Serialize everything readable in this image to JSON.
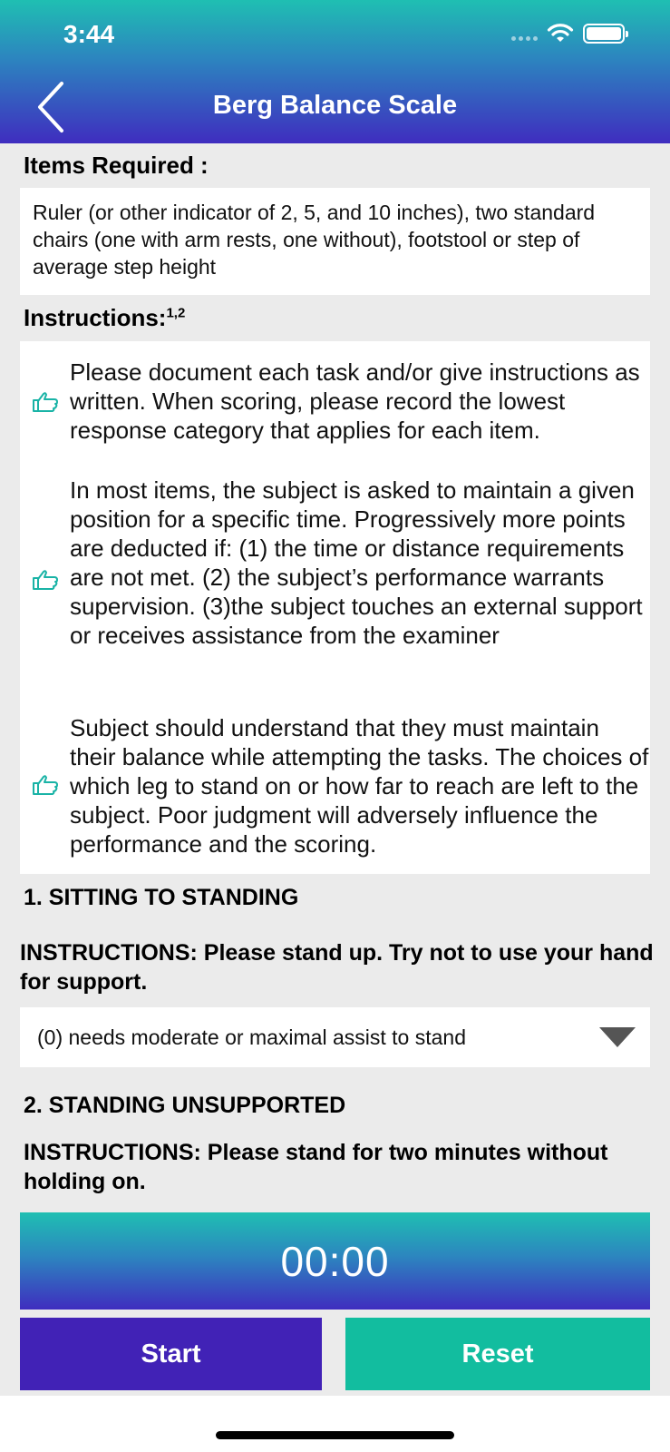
{
  "status_bar": {
    "time": "3:44"
  },
  "nav": {
    "title": "Berg Balance Scale",
    "back_icon": "chevron-left-icon"
  },
  "items_required": {
    "label": "Items Required :",
    "text": "Ruler (or other indicator of 2, 5, and 10 inches), two standard chairs (one with arm rests, one without), footstool or step of average step height"
  },
  "instructions": {
    "label": "Instructions:",
    "superscript": "1,2",
    "icon": "hand-pointing-right-icon",
    "accent_color": "#19b3a6",
    "items": [
      "Please document each task and/or give instructions as written. When scoring, please record the lowest response category that applies for each item.",
      "In most items, the subject is asked to maintain a given position for a specific time. Progressively more points are deducted if: (1) the time or distance requirements are not met. (2) the subject’s performance warrants supervision. (3)the subject touches an external support or receives assistance from the examiner",
      "Subject should understand that they must maintain their balance while attempting the tasks. The choices of which leg to stand on or how far to reach are left to the subject. Poor judgment will adversely influence the performance and the scoring."
    ]
  },
  "section1": {
    "title": "1. SITTING TO STANDING",
    "instructions": "INSTRUCTIONS: Please stand up. Try not to use your hand for support.",
    "selected_option": "(0) needs moderate or maximal assist to stand"
  },
  "section2": {
    "title": "2. STANDING UNSUPPORTED",
    "instructions": "INSTRUCTIONS: Please stand for two minutes without holding on."
  },
  "timer": {
    "value": "00:00"
  },
  "buttons": {
    "start": "Start",
    "reset": "Reset",
    "start_color": "#4122b6",
    "reset_color": "#12bd9f"
  }
}
